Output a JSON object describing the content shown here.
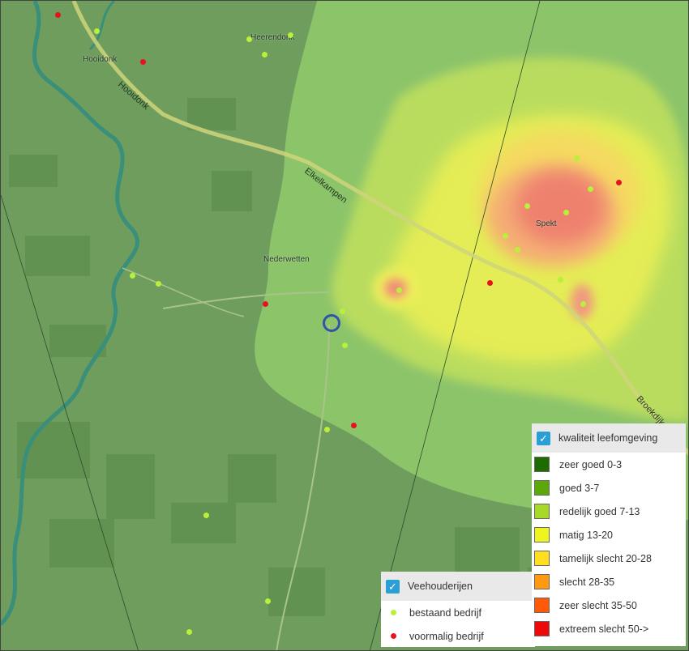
{
  "map": {
    "places": [
      {
        "id": "hooidonk",
        "label": "Hooidonk"
      },
      {
        "id": "heerendonk",
        "label": "Heerendonk"
      },
      {
        "id": "nederwetten",
        "label": "Nederwetten"
      },
      {
        "id": "spekt",
        "label": "Spekt"
      }
    ],
    "roads": [
      {
        "id": "hooidonk-road",
        "label": "Hooidonk"
      },
      {
        "id": "elkelkampen-road",
        "label": "Elkelkampen"
      },
      {
        "id": "broekdijk-road",
        "label": "Broekdijk"
      }
    ]
  },
  "legend_quality": {
    "title": "kwaliteit leefomgeving",
    "checked": true,
    "items": [
      {
        "label": "zeer goed 0-3",
        "color": "#1e6b00"
      },
      {
        "label": "goed 3-7",
        "color": "#5aa80a"
      },
      {
        "label": "redelijk goed 7-13",
        "color": "#a8d828"
      },
      {
        "label": "matig 13-20",
        "color": "#eef51e"
      },
      {
        "label": "tamelijk slecht 20-28",
        "color": "#ffdf20"
      },
      {
        "label": "slecht 28-35",
        "color": "#ff9a10"
      },
      {
        "label": "zeer slecht 35-50",
        "color": "#ff5a0a"
      },
      {
        "label": "extreem slecht 50->",
        "color": "#ee0a0a"
      }
    ]
  },
  "legend_livestock": {
    "title": "Veehouderijen",
    "checked": true,
    "items": [
      {
        "label": "bestaand bedrijf",
        "color": "#b9f03a"
      },
      {
        "label": "voormalig bedrijf",
        "color": "#e8121f"
      }
    ]
  }
}
